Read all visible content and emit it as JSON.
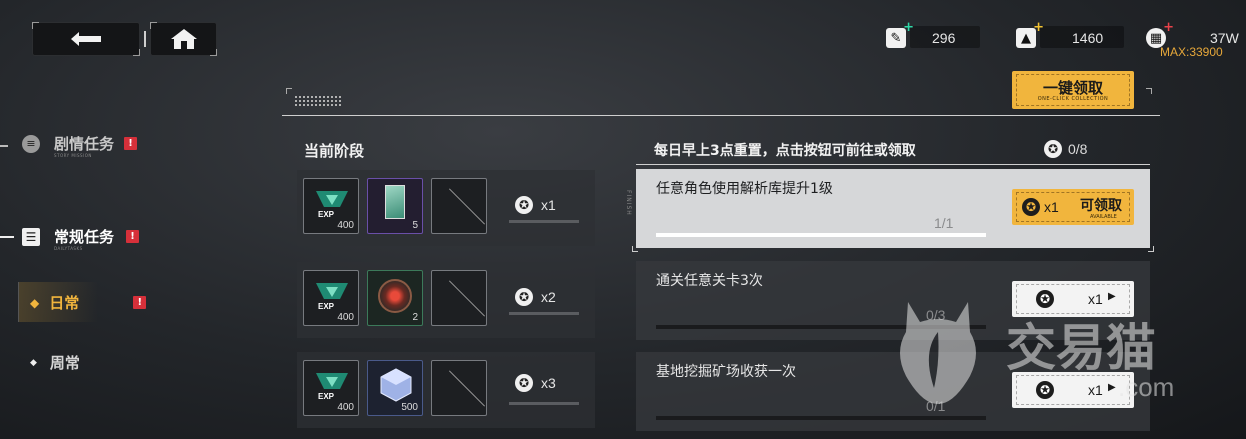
{
  "nav": {
    "back_icon": "back-arrow-icon",
    "home_icon": "home-icon"
  },
  "resources": [
    {
      "icon": "pen-icon",
      "value": "296",
      "plus_color": "#2fd9a8"
    },
    {
      "icon": "triangle-icon",
      "value": "1460",
      "plus_color": "#f1c232"
    },
    {
      "icon": "chip-icon",
      "value": "37W",
      "plus_color": "#e8424a",
      "sub": "MAX:33900"
    }
  ],
  "claim_all": {
    "label": "一键领取",
    "sub": "ONE-CLICK COLLECTION"
  },
  "sidebar": {
    "items": [
      {
        "label": "剧情任务",
        "sub": "STORY MISSION",
        "badge": "!"
      },
      {
        "label": "常规任务",
        "sub": "DAILYTASKS",
        "badge": "!"
      },
      {
        "label": "日常",
        "badge": "!"
      },
      {
        "label": "周常"
      }
    ]
  },
  "stage": {
    "title": "当前阶段"
  },
  "stage_rows": [
    {
      "items": [
        {
          "type": "exp",
          "count": "400"
        },
        {
          "type": "card",
          "count": "5"
        },
        {
          "type": "empty"
        }
      ],
      "reward": "x1"
    },
    {
      "items": [
        {
          "type": "exp",
          "count": "400"
        },
        {
          "type": "chip",
          "count": "2"
        },
        {
          "type": "empty"
        }
      ],
      "reward": "x2"
    },
    {
      "items": [
        {
          "type": "exp",
          "count": "400"
        },
        {
          "type": "cube",
          "count": "500"
        },
        {
          "type": "empty"
        }
      ],
      "reward": "x3"
    }
  ],
  "tasks_header": {
    "text": "每日早上3点重置，点击按钮可前往或领取",
    "progress": "0/8"
  },
  "finish_label": "FINISH",
  "tasks": [
    {
      "title": "任意角色使用解析库提升1级",
      "progress": "1/1",
      "fill": 1.0,
      "reward": "x1",
      "button": "可领取",
      "button_sub": "AVAILABLE",
      "state": "claimable"
    },
    {
      "title": "通关任意关卡3次",
      "progress": "0/3",
      "fill": 0.0,
      "reward": "x1",
      "state": "go"
    },
    {
      "title": "基地挖掘矿场收获一次",
      "progress": "0/1",
      "fill": 0.0,
      "reward": "x1",
      "state": "go"
    }
  ],
  "watermark": {
    "text": "交易猫",
    "domain": ".com"
  },
  "colors": {
    "accent": "#f1b53d",
    "badge": "#d6303a",
    "max": "#e7a83a"
  }
}
